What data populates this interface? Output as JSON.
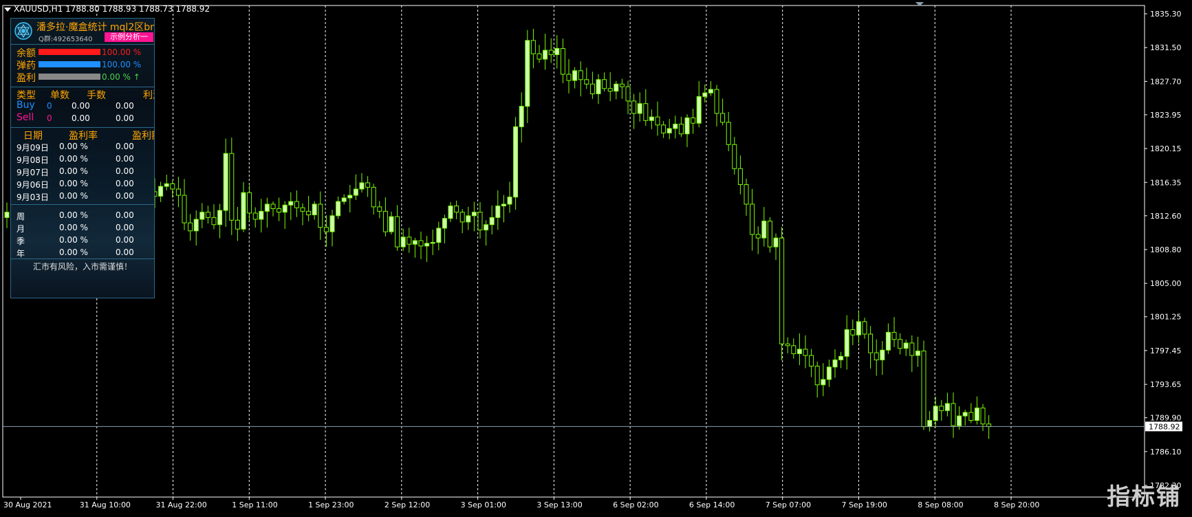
{
  "header": {
    "symbol_info": "XAUUSD,H1  1788.80 1788.93 1788.73 1788.92"
  },
  "panel": {
    "title": "潘多拉·魔盒统计 mql2区bm",
    "qq": "Q群:492653640",
    "analysis_button": "示例分析一",
    "bars": [
      {
        "label": "余额",
        "value": "100.00 %",
        "fraction": 1.0,
        "color": "#ff1a1a"
      },
      {
        "label": "弹药",
        "value": "100.00 %",
        "fraction": 1.0,
        "color": "#1e90ff"
      },
      {
        "label": "盈利",
        "value": "0.00 % ↑",
        "fraction": 1.0,
        "color": "#888888"
      }
    ],
    "orders_header": [
      "类型",
      "单数",
      "手数",
      "利润"
    ],
    "orders": [
      {
        "type": "Buy",
        "count": "0",
        "lots": "0.00",
        "profit": "0.00",
        "color": "#1e90ff"
      },
      {
        "type": "Sell",
        "count": "0",
        "lots": "0.00",
        "profit": "0.00",
        "color": "#ff1493"
      }
    ],
    "daily_header": [
      "日期",
      "盈利率",
      "盈利额"
    ],
    "daily": [
      {
        "date": "9月09日",
        "rate": "0.00 %",
        "amount": "0.00"
      },
      {
        "date": "9月08日",
        "rate": "0.00 %",
        "amount": "0.00"
      },
      {
        "date": "9月07日",
        "rate": "0.00 %",
        "amount": "0.00"
      },
      {
        "date": "9月06日",
        "rate": "0.00 %",
        "amount": "0.00"
      },
      {
        "date": "9月03日",
        "rate": "0.00 %",
        "amount": "0.00"
      }
    ],
    "periods": [
      {
        "period": "周",
        "rate": "0.00 %",
        "amount": "0.00"
      },
      {
        "period": "月",
        "rate": "0.00 %",
        "amount": "0.00"
      },
      {
        "period": "季",
        "rate": "0.00 %",
        "amount": "0.00"
      },
      {
        "period": "年",
        "rate": "0.00 %",
        "amount": "0.00"
      }
    ],
    "footer": "汇市有风险，入市需谨慎！"
  },
  "watermark": "指标铺",
  "colors": {
    "background": "#000000",
    "candle": "#7CFC00",
    "candle_body_up": "#ccffaa",
    "grid": "#ffffff",
    "price_line": "#8c9fb0"
  },
  "chart_data": {
    "type": "candlestick",
    "y_ticks": [
      "1835.30",
      "1831.50",
      "1827.70",
      "1823.95",
      "1820.15",
      "1816.35",
      "1812.60",
      "1808.80",
      "1805.00",
      "1801.25",
      "1797.45",
      "1793.65",
      "1789.90",
      "1786.10",
      "1782.30"
    ],
    "ylim": [
      1782.3,
      1835.3
    ],
    "x_ticks": [
      "30 Aug 2021",
      "31 Aug 10:00",
      "31 Aug 22:00",
      "1 Sep 11:00",
      "1 Sep 23:00",
      "2 Sep 12:00",
      "3 Sep 01:00",
      "3 Sep 13:00",
      "6 Sep 02:00",
      "6 Sep 14:00",
      "7 Sep 07:00",
      "7 Sep 19:00",
      "8 Sep 08:00",
      "8 Sep 20:00"
    ],
    "current_price": "1788.92",
    "closes": [
      1813.0,
      1812.2,
      1812.8,
      1811.9,
      1810.5,
      1811.4,
      1812.6,
      1813.8,
      1814.2,
      1813.1,
      1812.0,
      1812.9,
      1813.6,
      1814.0,
      1813.2,
      1812.5,
      1811.8,
      1809.5,
      1808.0,
      1810.2,
      1811.9,
      1812.8,
      1813.5,
      1814.6,
      1815.3,
      1814.8,
      1815.9,
      1816.2,
      1815.6,
      1814.9,
      1811.8,
      1810.9,
      1812.2,
      1813.0,
      1812.4,
      1811.6,
      1813.2,
      1819.6,
      1812.1,
      1811.1,
      1815.2,
      1812.9,
      1812.2,
      1813.1,
      1813.9,
      1813.4,
      1813.0,
      1813.8,
      1814.2,
      1813.5,
      1813.1,
      1812.7,
      1813.9,
      1811.3,
      1810.8,
      1812.6,
      1814.2,
      1814.6,
      1814.9,
      1815.6,
      1816.3,
      1815.8,
      1813.6,
      1813.1,
      1810.8,
      1812.5,
      1809.1,
      1810.2,
      1809.4,
      1809.8,
      1809.2,
      1809.5,
      1809.6,
      1811.2,
      1812.3,
      1813.7,
      1813.0,
      1811.9,
      1812.6,
      1813.0,
      1811.0,
      1811.6,
      1812.4,
      1813.7,
      1813.9,
      1814.7,
      1822.6,
      1824.9,
      1832.3,
      1830.8,
      1830.2,
      1831.2,
      1830.7,
      1831.4,
      1828.5,
      1827.8,
      1828.9,
      1827.9,
      1827.4,
      1826.3,
      1827.9,
      1826.9,
      1826.6,
      1827.4,
      1827.1,
      1825.5,
      1824.1,
      1825.2,
      1823.3,
      1823.7,
      1822.8,
      1821.9,
      1822.4,
      1822.9,
      1821.8,
      1823.6,
      1823.0,
      1826.0,
      1826.4,
      1826.8,
      1824.1,
      1823.1,
      1820.6,
      1817.9,
      1816.1,
      1813.9,
      1810.5,
      1810.1,
      1812.0,
      1809.1,
      1810.1,
      1798.2,
      1798.0,
      1797.1,
      1797.6,
      1796.9,
      1795.7,
      1793.6,
      1794.2,
      1795.6,
      1796.4,
      1796.8,
      1799.8,
      1799.2,
      1800.7,
      1799.3,
      1797.2,
      1796.4,
      1797.5,
      1799.5,
      1798.7,
      1797.7,
      1798.3,
      1796.9,
      1797.4,
      1788.9,
      1789.6,
      1791.2,
      1790.7,
      1791.5,
      1789.0,
      1790.1,
      1790.5,
      1789.6,
      1791.0,
      1789.2,
      1788.9
    ]
  }
}
